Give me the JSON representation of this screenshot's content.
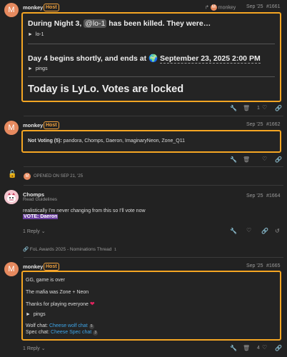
{
  "post1": {
    "author": "monkey",
    "tag": "Host",
    "reply_to": "monkey",
    "date": "Sep '25",
    "number": "#1661",
    "day_heading_pre": "During Night 3,",
    "day_heading_mention": "@lo-1",
    "day_heading_post": "has been killed. They were…",
    "spoiler1": "lo-1",
    "day4_pre": "Day 4 begins shortly, and ends at",
    "day4_date": "September 23, 2025 2:00 PM",
    "spoiler2": "pings",
    "big_line": "Today is LyLo. Votes are locked",
    "likes": "1"
  },
  "post2": {
    "author": "monkey",
    "tag": "Host",
    "date": "Sep '25",
    "number": "#1662",
    "label": "Not Voting (5):",
    "names": "pandora, Chomps, Daeron, ImaginaryNeon, Zone_Q11"
  },
  "opened": {
    "text": "OPENED ON SEP 21, '25"
  },
  "post3": {
    "author": "Chomps",
    "subtitle": "Read Guidelines",
    "date": "Sep '25",
    "number": "#1664",
    "body": "realistically I'm never changing from this so I'll vote now",
    "vote": "VOTE: Daeron",
    "reply_label": "1 Reply",
    "link_title": "FoL Awards 2025 - Nominations Thread",
    "link_count": "1"
  },
  "post4": {
    "author": "monkey",
    "tag": "Host",
    "date": "Sep '25",
    "number": "#1665",
    "line1": "GG, game is over",
    "line2": "The mafia was Zone + Neon",
    "line3": "Thanks for playing everyone",
    "spoiler": "pings",
    "wolf_label": "Wolf chat:",
    "wolf_link": "Cheese wolf chat",
    "wolf_count": "5",
    "spec_label": "Spec chat:",
    "spec_link": "Cheese Spec chat",
    "spec_count": "3",
    "reply_label": "1 Reply",
    "likes": "4"
  },
  "colors": {
    "highlight": "#f5a623",
    "avatar": "#e78a5f",
    "link": "#3ea5e8",
    "vote_bg": "#6b3fa0"
  }
}
